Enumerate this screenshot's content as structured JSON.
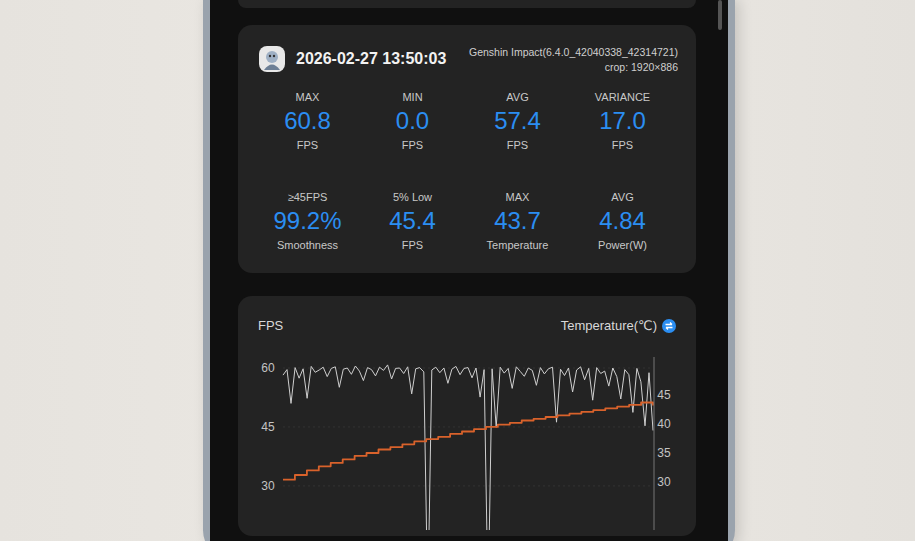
{
  "record": {
    "timestamp": "2026-02-27 13:50:03",
    "app": "Genshin Impact(6.4.0_42040338_42314721)",
    "crop": "crop: 1920×886"
  },
  "stats": [
    {
      "label": "MAX",
      "value": "60.8",
      "unit": "FPS"
    },
    {
      "label": "MIN",
      "value": "0.0",
      "unit": "FPS"
    },
    {
      "label": "AVG",
      "value": "57.4",
      "unit": "FPS"
    },
    {
      "label": "VARIANCE",
      "value": "17.0",
      "unit": "FPS"
    },
    {
      "label": "≥45FPS",
      "value": "99.2%",
      "unit": "Smoothness"
    },
    {
      "label": "5% Low",
      "value": "45.4",
      "unit": "FPS"
    },
    {
      "label": "MAX",
      "value": "43.7",
      "unit": "Temperature"
    },
    {
      "label": "AVG",
      "value": "4.84",
      "unit": "Power(W)"
    }
  ],
  "chart": {
    "title": "FPS",
    "toggle_label": "Temperature(℃)",
    "left_ticks": [
      "60",
      "45",
      "30"
    ],
    "right_ticks": [
      "45",
      "40",
      "35",
      "30"
    ],
    "series": [
      {
        "axis": "left",
        "color": "#cfcfcf",
        "values": [
          58.2,
          59.6,
          51.0,
          60.1,
          57.4,
          59.8,
          52.3,
          60.4,
          58.9,
          59.5,
          60.2,
          57.8,
          59.9,
          60.3,
          55.1,
          59.7,
          60.0,
          58.4,
          60.5,
          59.2,
          56.8,
          60.1,
          59.6,
          58.0,
          60.2,
          59.4,
          60.8,
          57.2,
          59.9,
          60.0,
          58.6,
          60.3,
          53.4,
          59.8,
          60.1,
          59.0,
          0.0,
          59.5,
          60.2,
          58.8,
          60.0,
          56.1,
          59.7,
          60.4,
          58.3,
          59.9,
          60.1,
          57.5,
          60.0,
          52.6,
          59.6,
          0.0,
          59.8,
          44.9,
          60.2,
          58.7,
          59.9,
          54.8,
          60.3,
          59.1,
          57.9,
          60.0,
          59.4,
          55.6,
          60.1,
          58.5,
          59.8,
          60.2,
          46.2,
          59.7,
          58.1,
          60.0,
          53.9,
          59.5,
          60.3,
          57.0,
          59.9,
          51.8,
          60.1,
          58.6,
          59.2,
          55.4,
          60.0,
          57.8,
          52.1,
          59.6,
          58.3,
          48.7,
          59.9,
          56.5,
          45.3,
          58.8,
          44.1
        ]
      },
      {
        "axis": "right",
        "color": "#d9622b",
        "values": [
          30.4,
          31.2,
          32.0,
          32.7,
          33.3,
          33.9,
          34.5,
          35.0,
          35.6,
          36.0,
          36.5,
          37.0,
          37.4,
          37.8,
          38.3,
          38.7,
          39.1,
          39.5,
          39.9,
          40.2,
          40.6,
          40.9,
          41.2,
          41.5,
          41.8,
          42.1,
          42.4,
          42.7,
          43.0,
          43.3,
          43.7,
          43.2
        ]
      }
    ]
  }
}
